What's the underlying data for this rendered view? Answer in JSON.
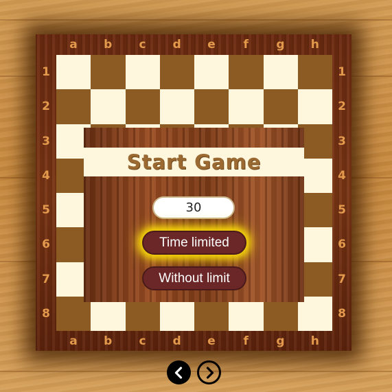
{
  "board": {
    "files": [
      "a",
      "b",
      "c",
      "d",
      "e",
      "f",
      "g",
      "h"
    ],
    "ranks": [
      "1",
      "2",
      "3",
      "4",
      "5",
      "6",
      "7",
      "8"
    ]
  },
  "dialog": {
    "title": "Start Game",
    "time_value": "30",
    "time_limited_label": "Time limited",
    "without_limit_label": "Without limit"
  },
  "nav": {
    "prev_icon": "chevron-left-icon",
    "next_icon": "chevron-right-icon"
  },
  "colors": {
    "light_square": "#fef6dd",
    "dark_square": "#8c5a23",
    "coordinate": "#e39a4c",
    "button": "#6b2727",
    "highlight_glow": "#f7d60a"
  }
}
